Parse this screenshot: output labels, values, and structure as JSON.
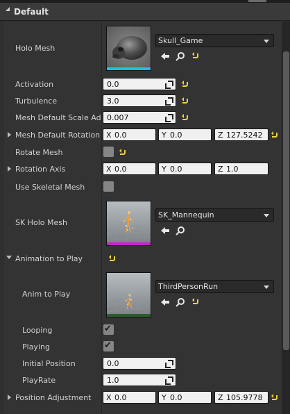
{
  "section": {
    "title": "Default"
  },
  "colors": {
    "mesh_bar": "#18c4e0",
    "skeletal_bar": "#d11cd1",
    "anim_bar": "#2c5e2c",
    "reset": "#f0d23c"
  },
  "icons": [
    "use-selected-asset-icon",
    "browse-asset-icon",
    "reset-to-default-icon",
    "expand-arrow-icon",
    "collapse-arrow-icon",
    "checkmark-icon",
    "dropdown-arrow-icon"
  ],
  "props": {
    "holo_mesh": {
      "label": "Holo Mesh",
      "asset": "Skull_Game"
    },
    "activation": {
      "label": "Activation",
      "value": "0.0"
    },
    "turbulence": {
      "label": "Turbulence",
      "value": "3.0"
    },
    "mesh_scale": {
      "label": "Mesh Default Scale Adju",
      "value": "0.007"
    },
    "mesh_rotation": {
      "label": "Mesh Default Rotation",
      "x_axis": "X",
      "x": "0.0",
      "y_axis": "Y",
      "y": "0.0",
      "z_axis": "Z",
      "z": "127.5242"
    },
    "rotate_mesh": {
      "label": "Rotate Mesh",
      "checked": false
    },
    "rotation_axis": {
      "label": "Rotation Axis",
      "x_axis": "X",
      "x": "0.0",
      "y_axis": "Y",
      "y": "0.0",
      "z_axis": "Z",
      "z": "1.0"
    },
    "use_skeletal": {
      "label": "Use Skeletal Mesh",
      "checked": false
    },
    "sk_holo_mesh": {
      "label": "SK Holo Mesh",
      "asset": "SK_Mannequin"
    },
    "animation": {
      "label": "Animation to Play",
      "anim_to_play": {
        "label": "Anim to Play",
        "asset": "ThirdPersonRun"
      },
      "looping": {
        "label": "Looping",
        "checked": true
      },
      "playing": {
        "label": "Playing",
        "checked": true
      },
      "initial_position": {
        "label": "Initial Position",
        "value": "0.0"
      },
      "play_rate": {
        "label": "PlayRate",
        "value": "1.0"
      }
    },
    "position_adjustment": {
      "label": "Position Adjustment",
      "x_axis": "X",
      "x": "0.0",
      "y_axis": "Y",
      "y": "0.0",
      "z_axis": "Z",
      "z": "105.9778"
    }
  },
  "glyphs": {
    "check": "✔"
  }
}
